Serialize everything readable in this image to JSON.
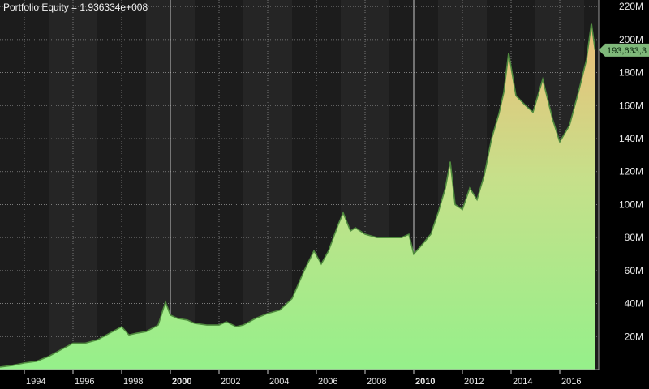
{
  "chart_data": {
    "type": "area",
    "title": "Portfolio Equity = 1.936334e+008",
    "series": [
      {
        "x": [
          1993.0,
          1993.5,
          1994.0,
          1994.5,
          1995.0,
          1995.5,
          1996.0,
          1996.5,
          1997.0,
          1997.5,
          1998.0,
          1998.3,
          1998.6,
          1999.0,
          1999.5,
          1999.8,
          2000.0,
          2000.3,
          2000.7,
          2001.0,
          2001.5,
          2002.0,
          2002.3,
          2002.7,
          2003.0,
          2003.5,
          2004.0,
          2004.5,
          2005.0,
          2005.5,
          2005.9,
          2006.2,
          2006.5,
          2006.9,
          2007.1,
          2007.4,
          2007.6,
          2008.0,
          2008.5,
          2009.0,
          2009.5,
          2009.8,
          2010.0,
          2010.3,
          2010.7,
          2011.0,
          2011.3,
          2011.5,
          2011.7,
          2012.0,
          2012.3,
          2012.6,
          2012.9,
          2013.2,
          2013.5,
          2013.7,
          2013.9,
          2014.2,
          2014.6,
          2014.9,
          2015.3,
          2015.7,
          2016.0,
          2016.4,
          2016.8,
          2017.1,
          2017.3,
          2017.45
        ],
        "values": [
          1.5,
          2.5,
          4,
          5,
          8,
          12,
          16,
          16,
          18,
          22,
          26,
          21,
          22,
          23,
          27,
          41,
          33,
          31,
          30,
          28,
          27,
          27,
          29,
          26,
          27,
          31,
          34,
          36,
          43,
          60,
          72,
          64,
          72,
          88,
          95,
          84,
          86,
          82,
          80,
          80,
          80,
          82,
          70,
          75,
          82,
          95,
          110,
          126,
          100,
          97,
          110,
          103,
          118,
          140,
          155,
          168,
          192,
          166,
          160,
          156,
          176,
          152,
          138,
          148,
          170,
          188,
          210,
          193.6
        ]
      }
    ],
    "x_ticks": [
      "1994",
      "1996",
      "1998",
      "2000",
      "2002",
      "2004",
      "2006",
      "2008",
      "2010",
      "2012",
      "2014",
      "2016"
    ],
    "bold_ticks": [
      "2000",
      "2010"
    ],
    "y_ticks": [
      "20M",
      "40M",
      "60M",
      "80M",
      "100M",
      "120M",
      "140M",
      "160M",
      "180M",
      "200M",
      "220M"
    ],
    "xlim": [
      1993.0,
      2017.6
    ],
    "ylim": [
      0,
      224
    ],
    "last_value_label": "193,633,3",
    "grid": true,
    "colors": {
      "background": "#000000",
      "plot_background": "#1c1c1c",
      "grid": "#8a8a8a",
      "fill_bottom": "#95f08a",
      "fill_mid": "#c6e08a",
      "fill_top": "#ecbd78",
      "line": "#4f8a3e",
      "label_box": "#7fb87a"
    }
  }
}
